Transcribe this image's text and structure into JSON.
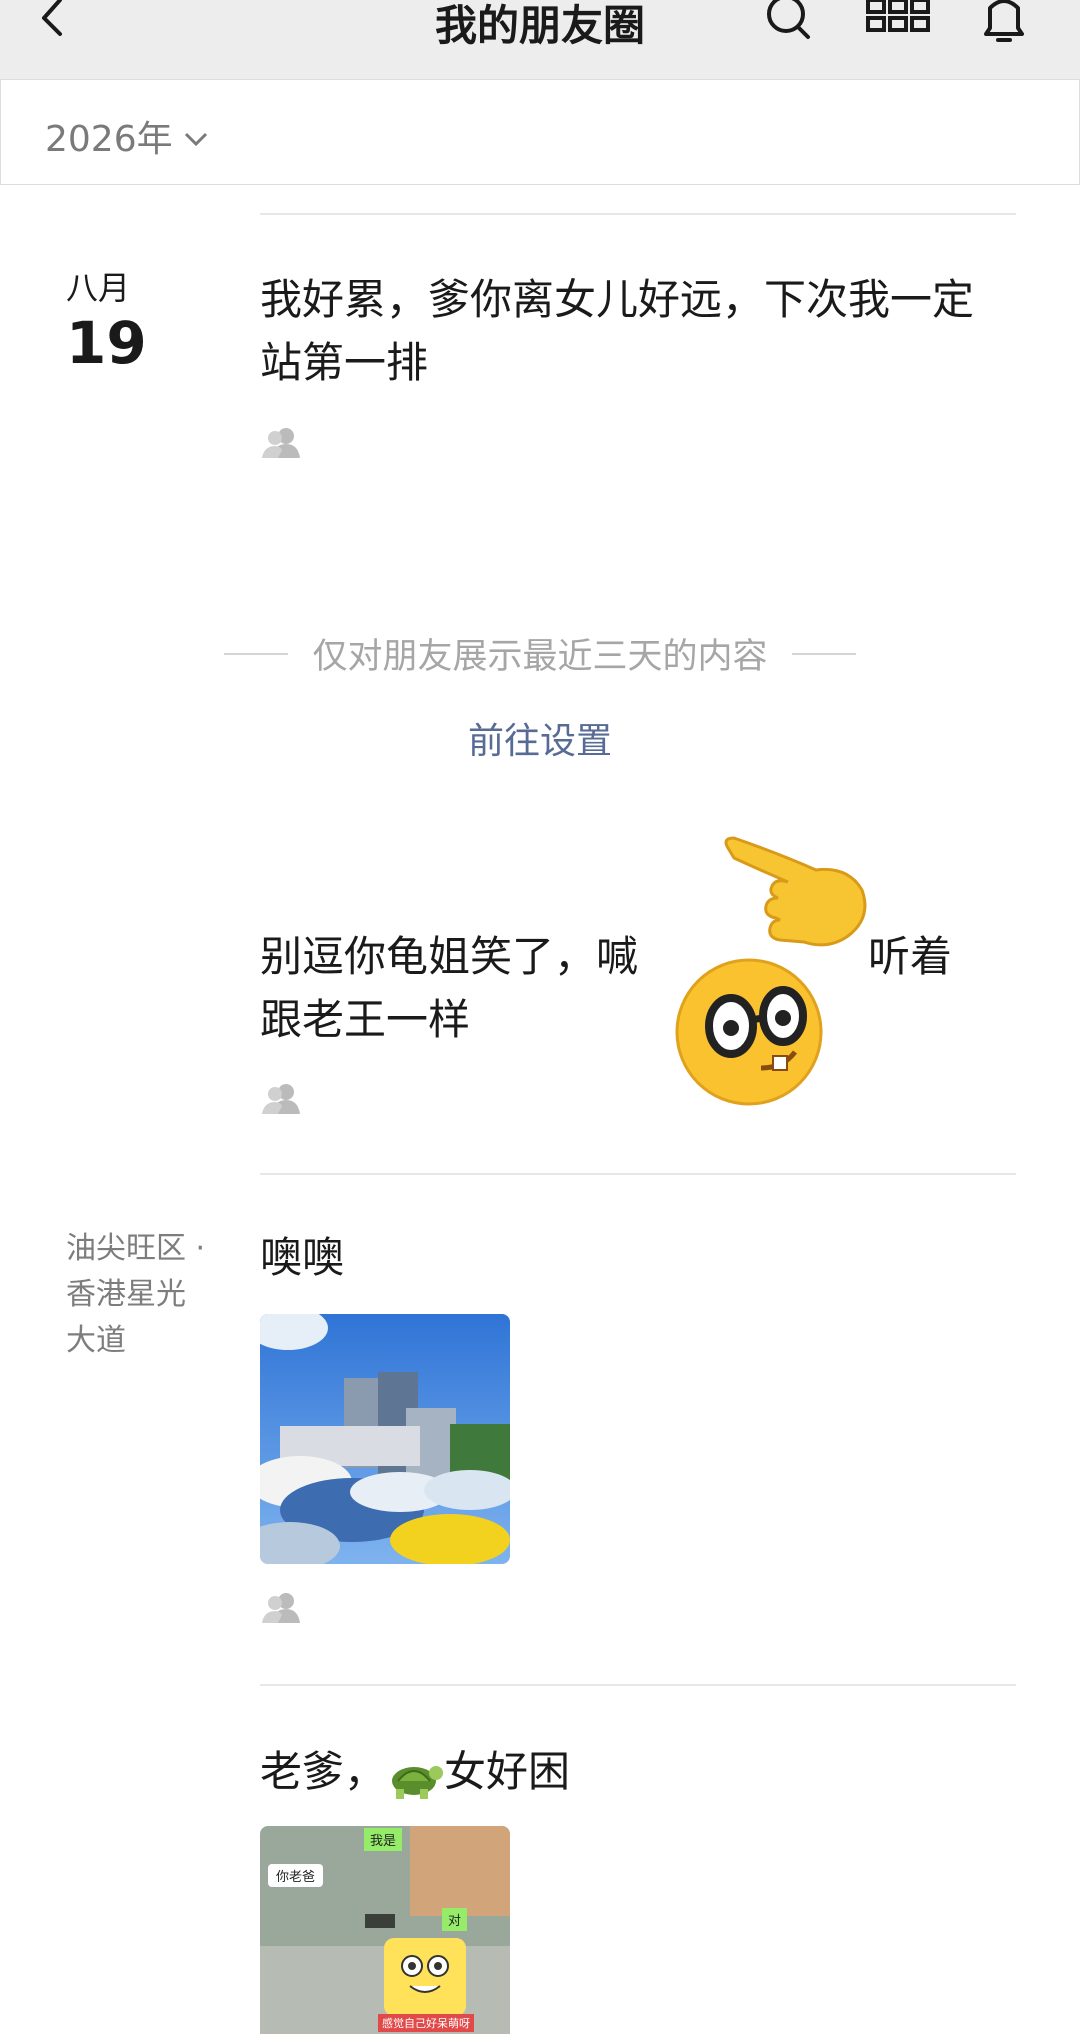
{
  "nav": {
    "title": "我的朋友圈",
    "back_icon": "chevron-left-icon",
    "search_icon": "search-icon",
    "grid_icon": "grid-icon",
    "bell_icon": "bell-icon"
  },
  "year_selector": {
    "label": "2026年"
  },
  "posts": [
    {
      "month": "八月",
      "day": "19",
      "text": "我好累，爹你离女儿好远，下次我一定站第一排"
    },
    {
      "text_part1": "别逗你龟姐笑了，喊",
      "text_part2": "听着",
      "text_line2": "跟老王一样"
    },
    {
      "location": "油尖旺区 · 香港星光大道",
      "text": "噢噢"
    },
    {
      "text_part1": "老爹，",
      "text_part2": "女好困"
    }
  ],
  "notice": {
    "text": "仅对朋友展示最近三天的内容",
    "link": "前往设置"
  },
  "screenshot_thumb": {
    "bubble_left": "你老爸",
    "bubble_top": "我是",
    "bubble_right": "对",
    "caption": "感觉自己好呆萌呀"
  },
  "colors": {
    "link": "#576b95",
    "nav_bg": "#ededed",
    "muted": "#a6a6a6"
  }
}
